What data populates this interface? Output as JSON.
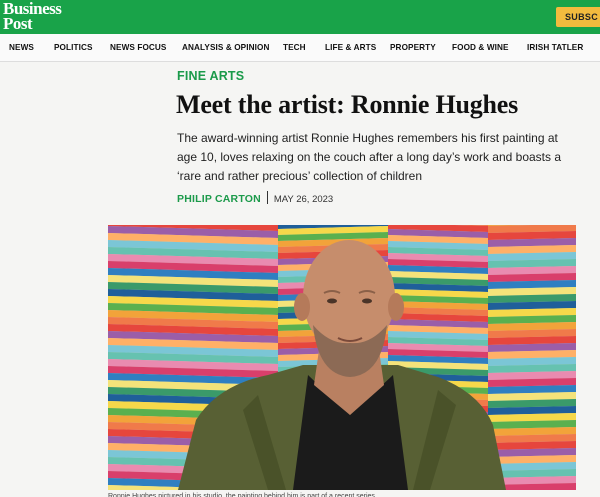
{
  "brand": {
    "name_line1": "Business",
    "name_line2": "Post",
    "accent": "#19a349",
    "subscribe_color": "#f3bb3e"
  },
  "header": {
    "subscribe_label": "SUBSC"
  },
  "nav": {
    "items": [
      "NEWS",
      "POLITICS",
      "NEWS FOCUS",
      "ANALYSIS & OPINION",
      "TECH",
      "LIFE & ARTS",
      "PROPERTY",
      "FOOD & WINE",
      "IRISH TATLER"
    ]
  },
  "article": {
    "section": "FINE ARTS",
    "headline": "Meet the artist: Ronnie Hughes",
    "standfirst": "The award-winning artist Ronnie Hughes remembers his first painting at age 10, loves relaxing on the couch after a long day’s work and boasts a ‘rare and rather precious’ collection of children",
    "author": "PHILIP CARTON",
    "date": "MAY 26, 2023"
  },
  "image": {
    "caption": "Ronnie Hughes pictured in his studio, the painting behind him is part of a recent series"
  }
}
